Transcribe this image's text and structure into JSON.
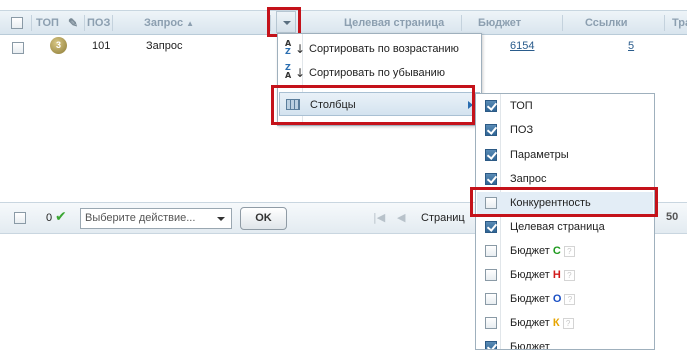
{
  "header": {
    "col_top": "ТОП",
    "col_pos": "ПОЗ",
    "col_query": "Запрос",
    "col_query_sort_icon": "triangle-up-icon",
    "col_target": "Целевая страница",
    "col_budget": "Бюджет",
    "col_links": "Ссылки",
    "col_traffic": "Трафи"
  },
  "row": {
    "top_badge": "3",
    "pos": "101",
    "query": "Запрос",
    "budget": "6154",
    "links": "5"
  },
  "column_menu": {
    "items": [
      {
        "icon": "sort-ascending-icon",
        "label": "Сортировать по возрастанию"
      },
      {
        "icon": "sort-descending-icon",
        "label": "Сортировать по убыванию"
      },
      {
        "icon": "columns-icon",
        "label": "Столбцы"
      }
    ],
    "sort_asc_glyph_top": "A",
    "sort_asc_glyph_bottom": "Z",
    "sort_desc_glyph_top": "Z",
    "sort_desc_glyph_bottom": "A"
  },
  "columns_submenu": {
    "items": [
      {
        "label": "ТОП",
        "checked": true
      },
      {
        "label": "ПОЗ",
        "checked": true
      },
      {
        "label": "Параметры",
        "checked": true
      },
      {
        "label": "Запрос",
        "checked": true
      },
      {
        "label": "Конкурентность",
        "checked": false
      },
      {
        "label": "Целевая страница",
        "checked": true
      },
      {
        "label": "Бюджет",
        "suffix": "С",
        "suffix_color": "#1e9a1e",
        "checked": false
      },
      {
        "label": "Бюджет",
        "suffix": "Н",
        "suffix_color": "#d21a1a",
        "checked": false
      },
      {
        "label": "Бюджет",
        "suffix": "О",
        "suffix_color": "#1a4fc4",
        "checked": false
      },
      {
        "label": "Бюджет",
        "suffix": "К",
        "suffix_color": "#e6a400",
        "checked": false
      },
      {
        "label": "Бюджет",
        "checked": true
      }
    ],
    "help_glyph": "?"
  },
  "bottom_bar": {
    "count": "0",
    "check_icon": "green-check-icon",
    "action_placeholder": "Выберите действие...",
    "ok_label": "OK",
    "page_label": "Страниц",
    "per_page": "50"
  },
  "colors": {
    "highlight": "#c4121a",
    "header_text": "#8c9fb0",
    "link": "#2a5c8c"
  }
}
